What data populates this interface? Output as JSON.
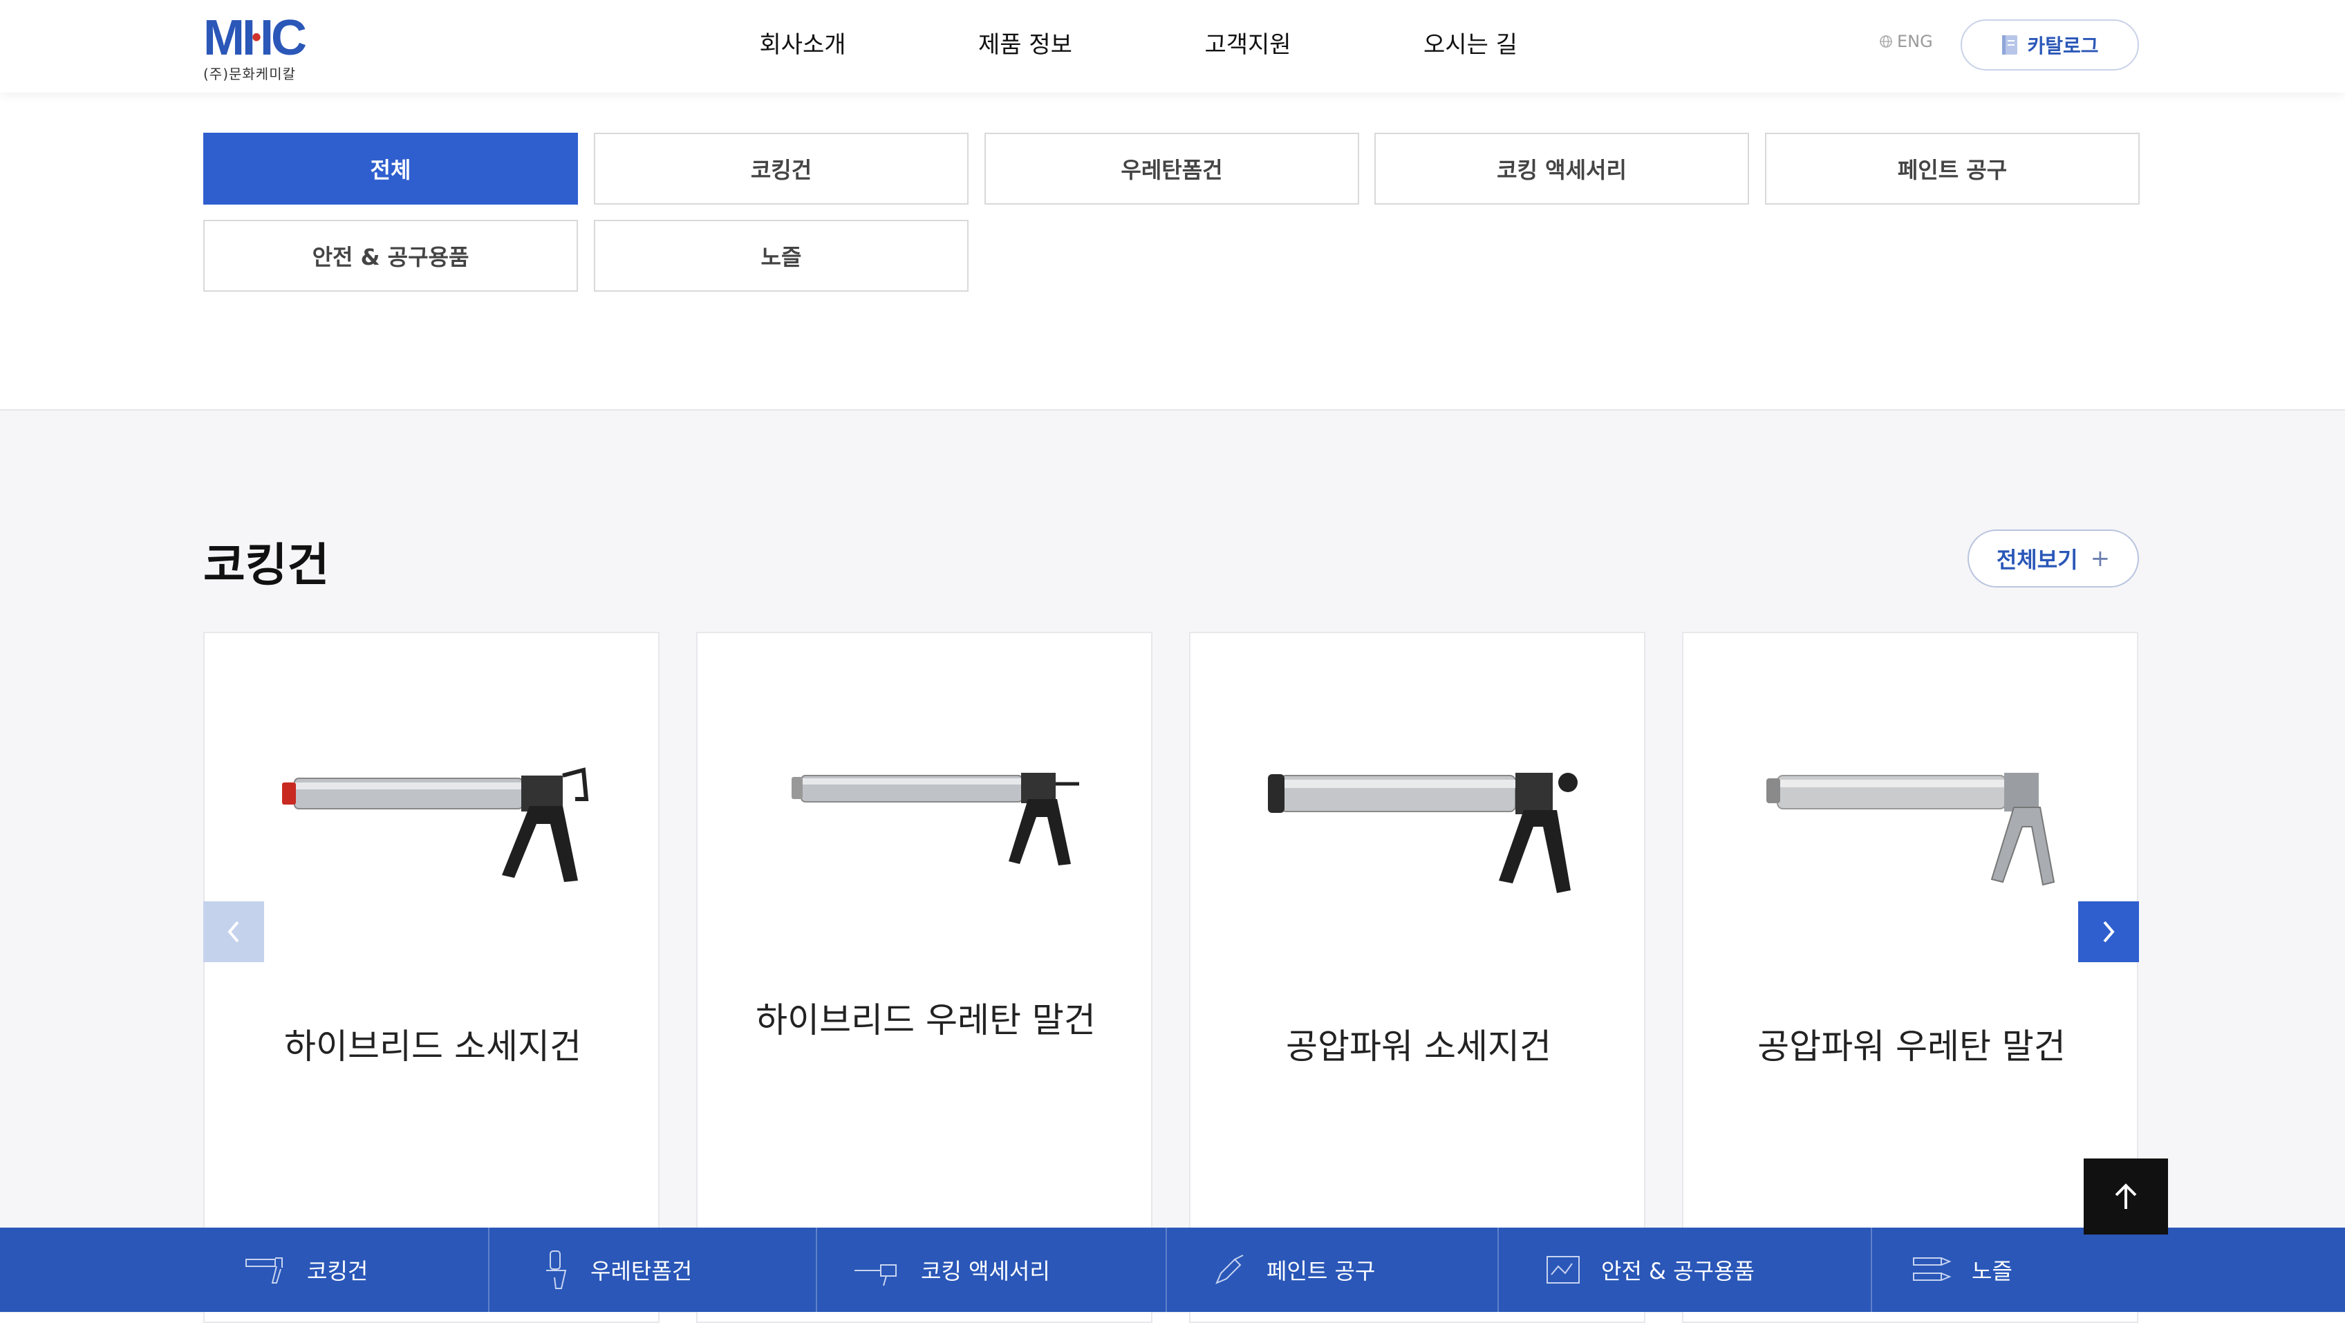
{
  "header": {
    "logo_mark_1": "MI",
    "logo_mark_2": "IC",
    "logo_sub": "(주)문화케미칼",
    "nav": [
      "회사소개",
      "제품 정보",
      "고객지원",
      "오시는 길"
    ],
    "lang": "ENG",
    "catalog": "카탈로그"
  },
  "filters": [
    "전체",
    "코킹건",
    "우레탄폼건",
    "코킹 액세서리",
    "페인트 공구",
    "안전 & 공구용품",
    "노즐"
  ],
  "section": {
    "title": "코킹건",
    "view_all": "전체보기",
    "view_all_icon": "+"
  },
  "products": [
    {
      "name": "하이브리드 소세지건"
    },
    {
      "name": "하이브리드 우레탄 말건"
    },
    {
      "name": "공압파워 소세지건"
    },
    {
      "name": "공압파워 우레탄 말건"
    }
  ],
  "bottom_bar": [
    "코킹건",
    "우레탄폼건",
    "코킹 액세서리",
    "페인트 공구",
    "안전 & 공구용품",
    "노즐"
  ],
  "colors": {
    "brand_blue": "#2a57b8",
    "active_filter": "#2f5fcf",
    "section_bg": "#f6f6f8",
    "logo_red": "#d0342c"
  },
  "icons": {
    "prev": "chevron-left-icon",
    "next": "chevron-right-icon",
    "top": "arrow-up-icon",
    "lang": "globe-icon",
    "catalog": "book-icon"
  }
}
